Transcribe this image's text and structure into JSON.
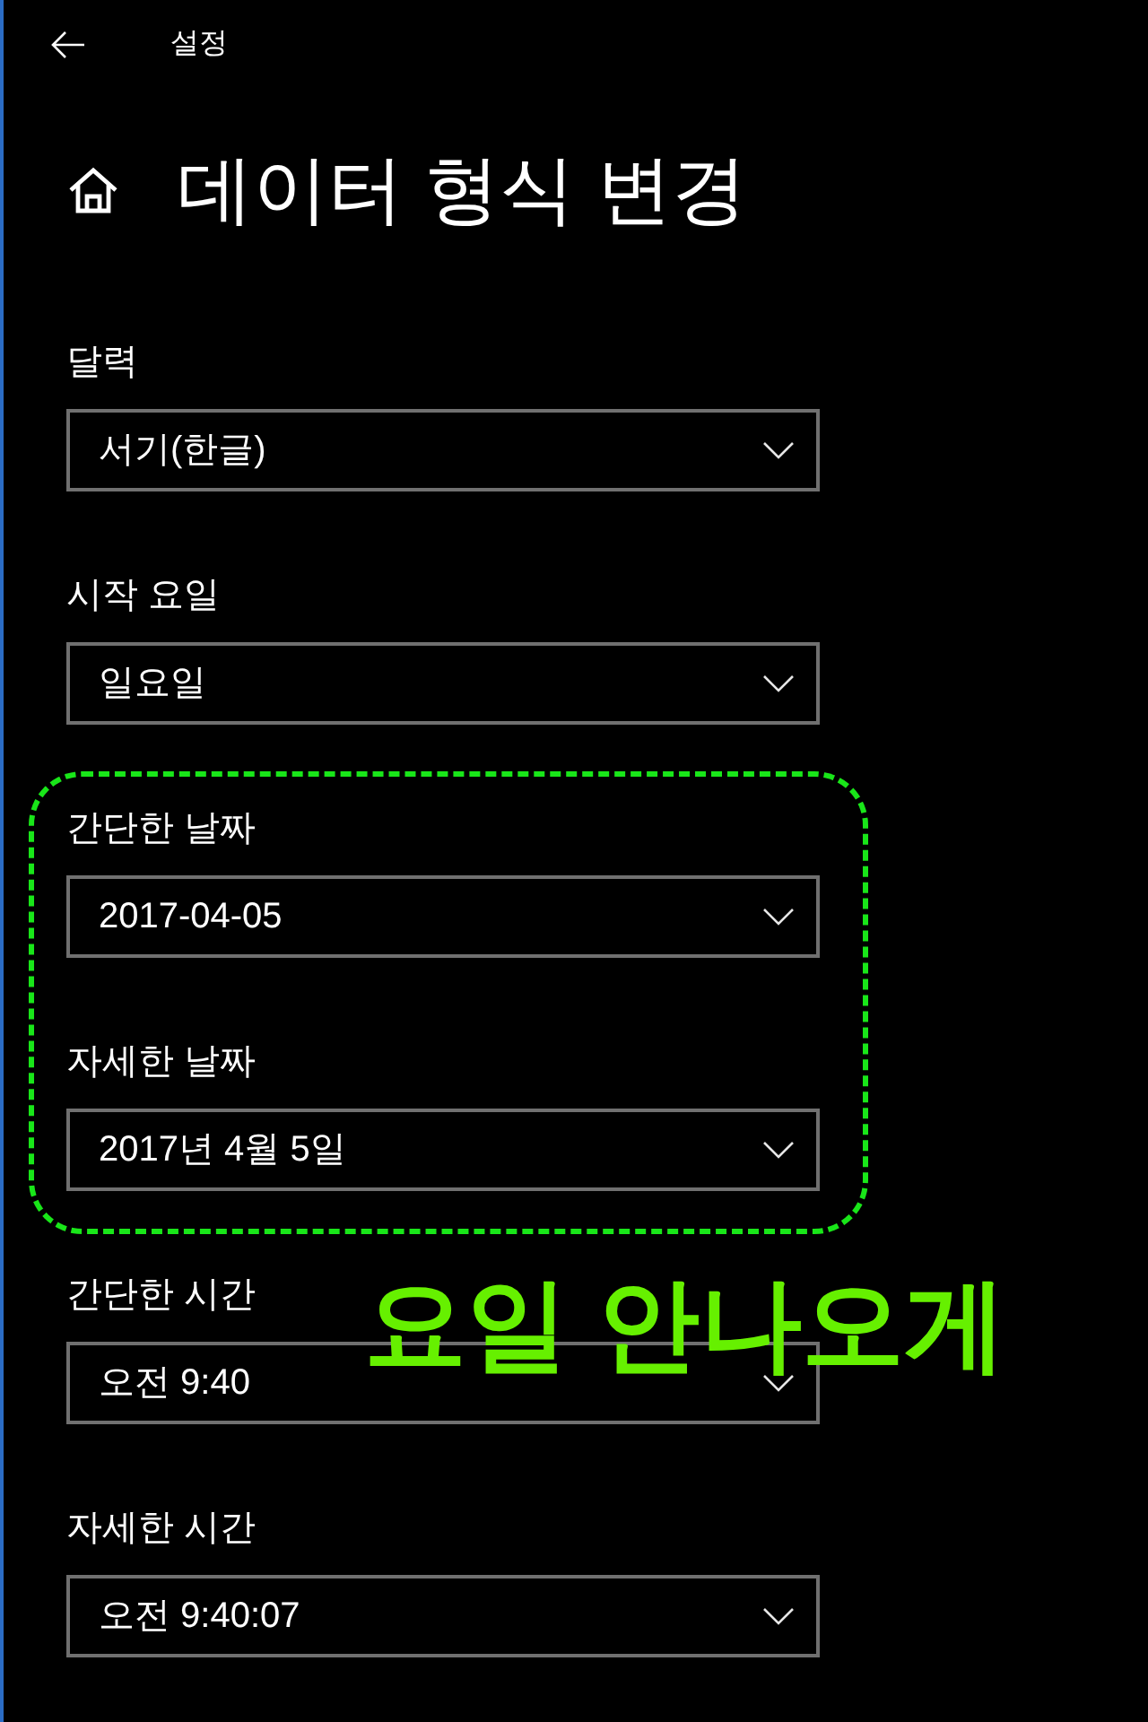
{
  "header": {
    "title": "설정"
  },
  "page": {
    "title": "데이터 형식 변경"
  },
  "settings": [
    {
      "label": "달력",
      "value": "서기(한글)",
      "highlighted": false
    },
    {
      "label": "시작 요일",
      "value": "일요일",
      "highlighted": false
    },
    {
      "label": "간단한 날짜",
      "value": "2017-04-05",
      "highlighted": true
    },
    {
      "label": "자세한 날짜",
      "value": "2017년 4월 5일",
      "highlighted": true
    },
    {
      "label": "간단한 시간",
      "value": "오전 9:40",
      "highlighted": false
    },
    {
      "label": "자세한 시간",
      "value": "오전 9:40:07",
      "highlighted": false
    }
  ],
  "annotation": {
    "note": "요일 안나오게"
  }
}
